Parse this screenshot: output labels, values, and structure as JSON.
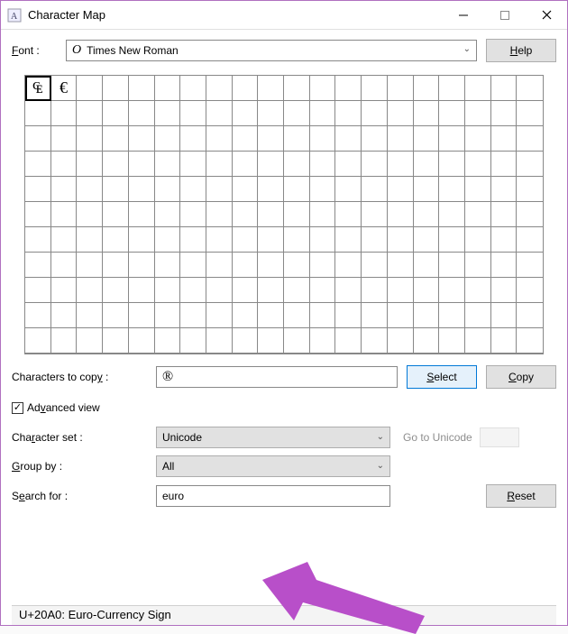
{
  "window": {
    "title": "Character Map"
  },
  "font_row": {
    "label": "Font :",
    "selected": "Times New Roman"
  },
  "help_button": "Help",
  "grid": {
    "cols": 20,
    "rows": 11,
    "chars": [
      "₠",
      "€"
    ],
    "selected_index": 0
  },
  "copy_row": {
    "label": "Characters to copy :",
    "value": "®",
    "select_btn": "Select",
    "copy_btn": "Copy"
  },
  "advanced": {
    "checked": true,
    "label": "Advanced view"
  },
  "charset_row": {
    "label": "Character set :",
    "value": "Unicode",
    "goto_label": "Go to Unicode"
  },
  "group_row": {
    "label": "Group by :",
    "value": "All"
  },
  "search_row": {
    "label": "Search for :",
    "value": "euro",
    "reset_btn": "Reset"
  },
  "status": "U+20A0: Euro-Currency Sign"
}
